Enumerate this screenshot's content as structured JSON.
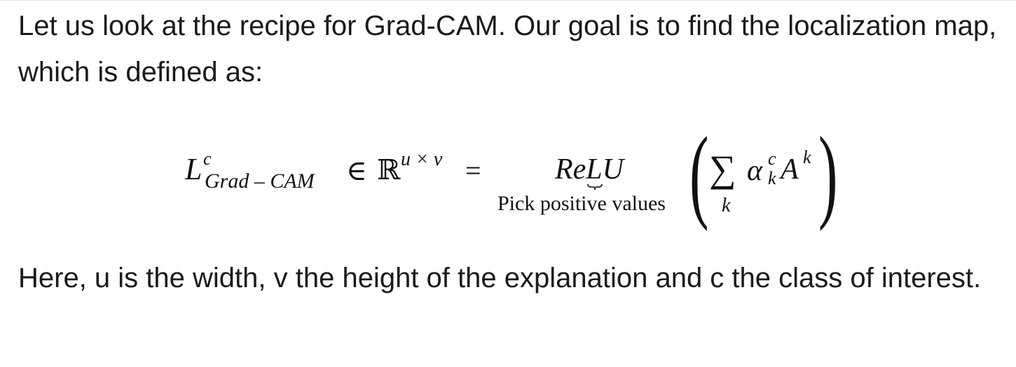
{
  "intro_text": "Let us look at the recipe for Grad-CAM. Our goal is to find the localization map, which is defined as:",
  "equation": {
    "lhs_symbol": "L",
    "lhs_superscript": "c",
    "lhs_subscript": "Grad – CAM",
    "element_of": "∈",
    "real_set": "ℝ",
    "dim_superscript": "u × v",
    "equals": "=",
    "relu_label": "ReLU",
    "relu_underbrace_note": "Pick positive values",
    "open_paren": "(",
    "sum_symbol": "∑",
    "sum_index": "k",
    "alpha_symbol": "α",
    "alpha_superscript": "c",
    "alpha_subscript": "k",
    "activation_symbol": "A",
    "activation_superscript": "k",
    "close_paren": ")"
  },
  "explanation_text": "Here, u is the width, v the height of the explanation and c the class of interest."
}
